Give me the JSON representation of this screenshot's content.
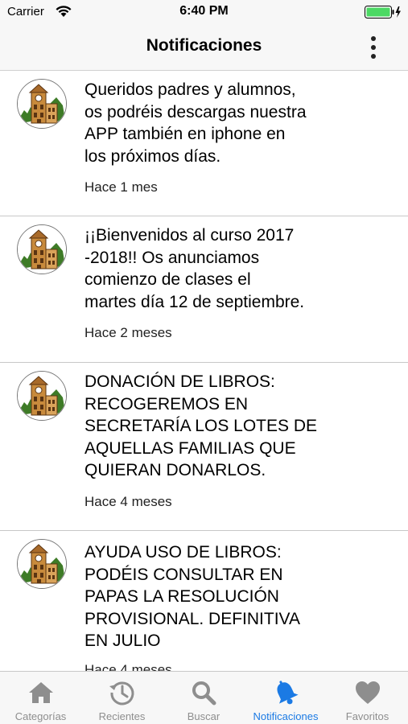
{
  "status_bar": {
    "carrier": "Carrier",
    "time": "6:40 PM",
    "wifi_icon": "wifi-icon",
    "battery_icon": "battery-charging-icon",
    "battery_color": "#4cd964"
  },
  "nav_bar": {
    "title": "Notificaciones",
    "menu_icon": "kebab-menu-icon"
  },
  "notifications": [
    {
      "text": "Queridos padres y alumnos,\nos podréis descargas nuestra\nAPP también en iphone en\nlos próximos días.",
      "time": "Hace 1 mes",
      "avatar_icon": "school-building-icon"
    },
    {
      "text": "¡¡Bienvenidos al curso 2017\n-2018!! Os anunciamos\ncomienzo de clases el\nmartes día 12 de septiembre.",
      "time": "Hace 2 meses",
      "avatar_icon": "school-building-icon"
    },
    {
      "text": "DONACIÓN DE LIBROS:\nRECOGEREMOS EN\nSECRETARÍA LOS LOTES DE\nAQUELLAS FAMILIAS QUE\nQUIERAN DONARLOS.",
      "time": "Hace 4 meses",
      "avatar_icon": "school-building-icon"
    },
    {
      "text": "AYUDA USO DE LIBROS:\nPODÉIS CONSULTAR EN\nPAPAS LA RESOLUCIÓN\nPROVISIONAL. DEFINITIVA\nEN JULIO",
      "time": "Hace 4 meses",
      "avatar_icon": "school-building-icon"
    }
  ],
  "tab_bar": {
    "active_color": "#1b7ae4",
    "inactive_color": "#8e8e8e",
    "tabs": [
      {
        "label": "Categorías",
        "icon": "home-icon",
        "active": false
      },
      {
        "label": "Recientes",
        "icon": "clock-history-icon",
        "active": false
      },
      {
        "label": "Buscar",
        "icon": "search-icon",
        "active": false
      },
      {
        "label": "Notificaciones",
        "icon": "bell-icon",
        "active": true
      },
      {
        "label": "Favoritos",
        "icon": "heart-icon",
        "active": false
      }
    ]
  }
}
